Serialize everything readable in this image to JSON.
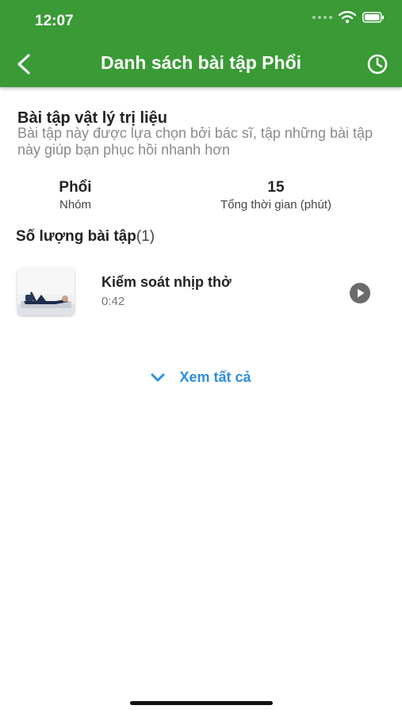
{
  "status_bar": {
    "time": "12:07"
  },
  "header": {
    "title": "Danh sách bài tập Phổi"
  },
  "section": {
    "title": "Bài tập vật lý trị liệu",
    "description": "Bài tập này được lựa chọn bởi bác sĩ, tập những bài tập này giúp bạn phục hồi nhanh hơn"
  },
  "stats": {
    "group_value": "Phổi",
    "group_label": "Nhóm",
    "time_value": "15",
    "time_label": "Tổng thời gian (phút)"
  },
  "exercise_count": {
    "label": "Số lượng bài tập",
    "count": "(1)"
  },
  "exercises": [
    {
      "name": "Kiểm soát nhịp thở",
      "duration": "0:42"
    }
  ],
  "see_all": "Xem tất cả",
  "colors": {
    "header": "#3a9a36",
    "link": "#2f8fe0",
    "play": "#6b6b6b"
  }
}
